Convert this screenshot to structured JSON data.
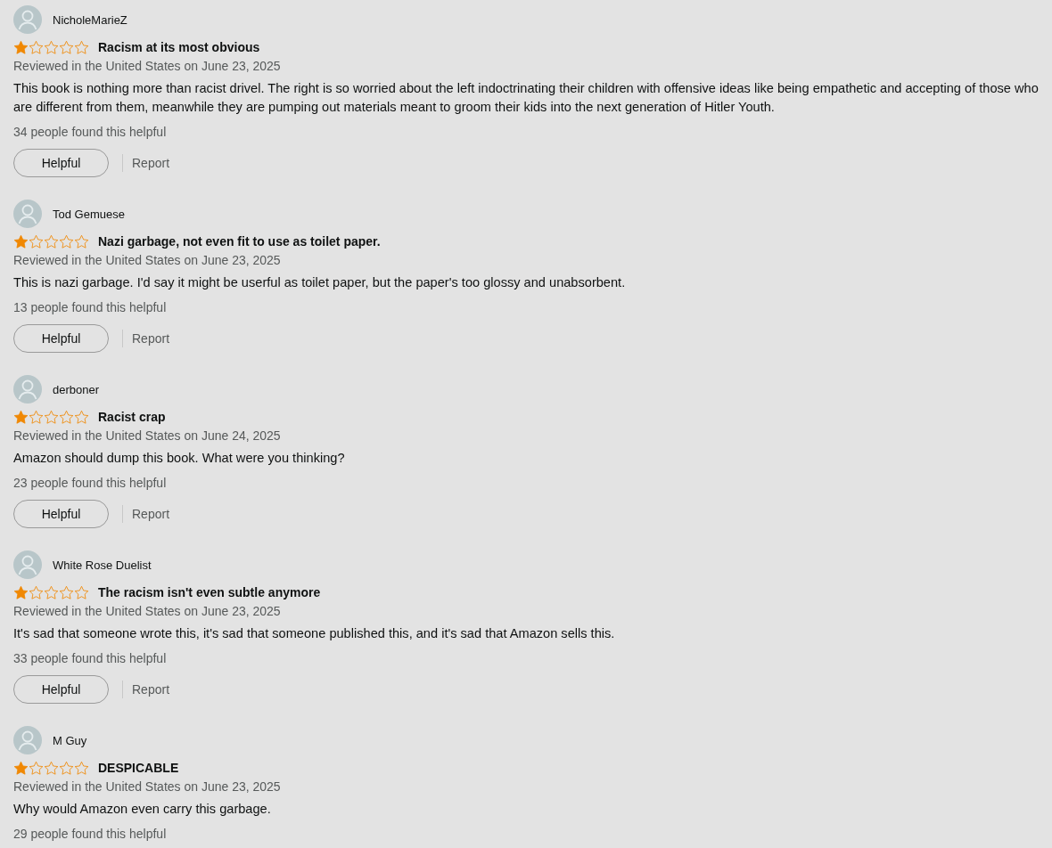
{
  "reviews": [
    {
      "author": "NicholeMarieZ",
      "stars": 1,
      "title": "Racism at its most obvious",
      "date": "Reviewed in the United States on June 23, 2025",
      "body": "This book is nothing more than racist drivel. The right is so worried about the left indoctrinating their children with offensive ideas like being empathetic and accepting of those who are different from them, meanwhile they are pumping out materials meant to groom their kids into the next generation of Hitler Youth.",
      "helpful_count": "34 people found this helpful",
      "helpful_button": "Helpful",
      "report_link": "Report"
    },
    {
      "author": "Tod Gemuese",
      "stars": 1,
      "title": "Nazi garbage, not even fit to use as toilet paper.",
      "date": "Reviewed in the United States on June 23, 2025",
      "body": "This is nazi garbage. I'd say it might be userful as toilet paper, but the paper's too glossy and unabsorbent.",
      "helpful_count": "13 people found this helpful",
      "helpful_button": "Helpful",
      "report_link": "Report"
    },
    {
      "author": "derboner",
      "stars": 1,
      "title": "Racist crap",
      "date": "Reviewed in the United States on June 24, 2025",
      "body": "Amazon should dump this book. What were you thinking?",
      "helpful_count": "23 people found this helpful",
      "helpful_button": "Helpful",
      "report_link": "Report"
    },
    {
      "author": "White Rose Duelist",
      "stars": 1,
      "title": "The racism isn't even subtle anymore",
      "date": "Reviewed in the United States on June 23, 2025",
      "body": "It's sad that someone wrote this, it's sad that someone published this, and it's sad that Amazon sells this.",
      "helpful_count": "33 people found this helpful",
      "helpful_button": "Helpful",
      "report_link": "Report"
    },
    {
      "author": "M Guy",
      "stars": 1,
      "title": "DESPICABLE",
      "date": "Reviewed in the United States on June 23, 2025",
      "body": "Why would Amazon even carry this garbage.",
      "helpful_count": "29 people found this helpful"
    }
  ]
}
